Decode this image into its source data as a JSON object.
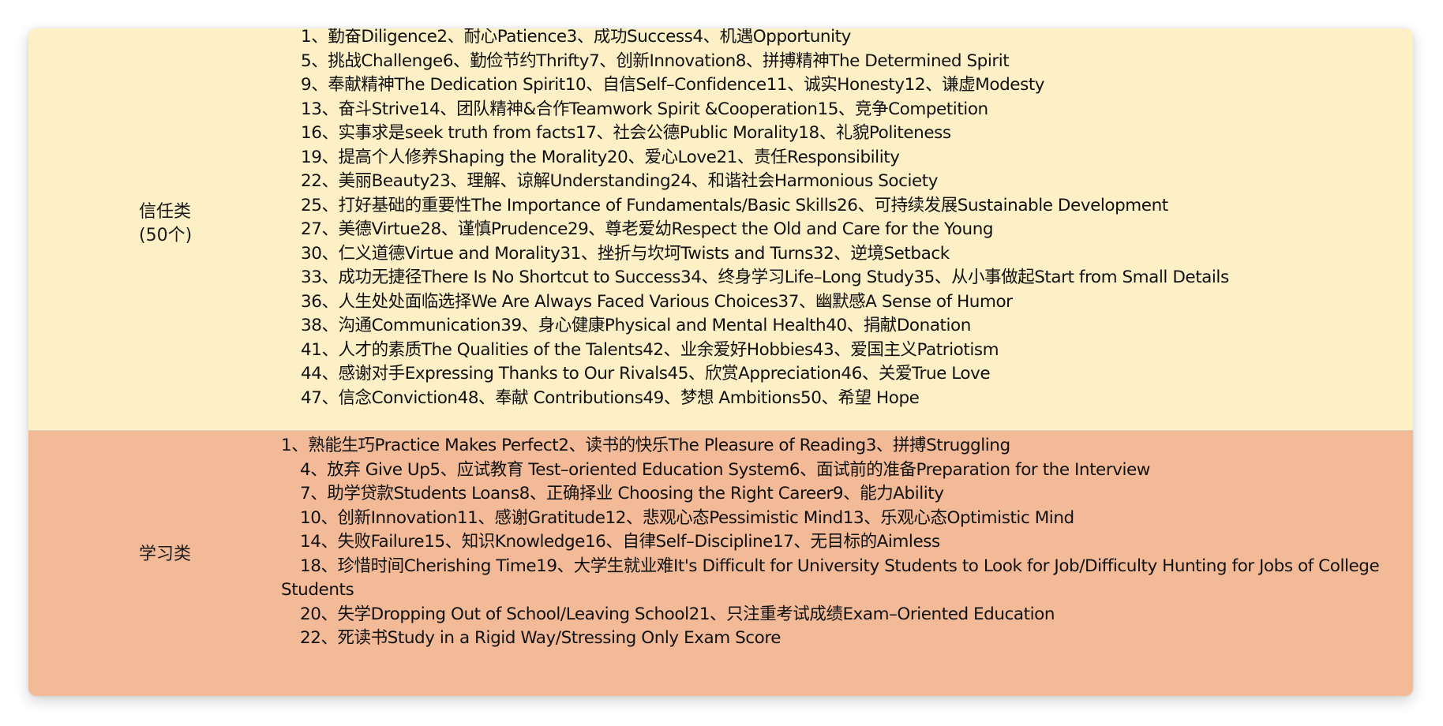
{
  "sections": [
    {
      "label_line1": "信任类",
      "label_line2": "(50个)",
      "items": [
        "1、勤奋Diligence2、耐心Patience3、成功Success4、机遇Opportunity",
        "5、挑战Challenge6、勤俭节约Thrifty7、创新Innovation8、拼搏精神The Determined Spirit",
        "9、奉献精神The Dedication Spirit10、自信Self–Confidence11、诚实Honesty12、谦虚Modesty",
        "13、奋斗Strive14、团队精神&合作Teamwork Spirit &Cooperation15、竞争Competition",
        "16、实事求是seek truth from facts17、社会公德Public Morality18、礼貌Politeness",
        "19、提高个人修养Shaping the Morality20、爱心Love21、责任Responsibility",
        "22、美丽Beauty23、理解、谅解Understanding24、和谐社会Harmonious Society",
        "25、打好基础的重要性The Importance of Fundamentals/Basic Skills26、可持续发展Sustainable Development",
        "27、美德Virtue28、谨慎Prudence29、尊老爱幼Respect the Old and Care for the Young",
        "30、仁义道德Virtue and Morality31、挫折与坎坷Twists and Turns32、逆境Setback",
        "33、成功无捷径There Is No Shortcut to Success34、终身学习Life–Long Study35、从小事做起Start from Small Details",
        "36、人生处处面临选择We Are Always Faced Various Choices37、幽默感A Sense of Humor",
        "38、沟通Communication39、身心健康Physical and Mental Health40、捐献Donation",
        "41、人才的素质The Qualities of the Talents42、业余爱好Hobbies43、爱国主义Patriotism",
        "44、感谢对手Expressing Thanks to Our Rivals45、欣赏Appreciation46、关爱True Love",
        "47、信念Conviction48、奉献 Contributions49、梦想 Ambitions50、希望 Hope"
      ]
    },
    {
      "label_line1": "学习类",
      "label_line2": "",
      "items": [
        "1、熟能生巧Practice Makes Perfect2、读书的快乐The Pleasure of Reading3、拼搏Struggling",
        "4、放弃 Give Up5、应试教育 Test–oriented Education System6、面试前的准备Preparation for the Interview",
        "7、助学贷款Students Loans8、正确择业 Choosing the Right Career9、能力Ability",
        "10、创新Innovation11、感谢Gratitude12、悲观心态Pessimistic Mind13、乐观心态Optimistic Mind",
        "14、失败Failure15、知识Knowledge16、自律Self–Discipline17、无目标的Aimless",
        "18、珍惜时间Cherishing Time19、大学生就业难It's Difficult for University Students to Look for Job/Difficulty Hunting for Jobs of College Students",
        "20、失学Dropping Out of School/Leaving School21、只注重考试成绩Exam–Oriented Education",
        "22、死读书Study in a Rigid Way/Stressing Only Exam Score"
      ]
    }
  ]
}
